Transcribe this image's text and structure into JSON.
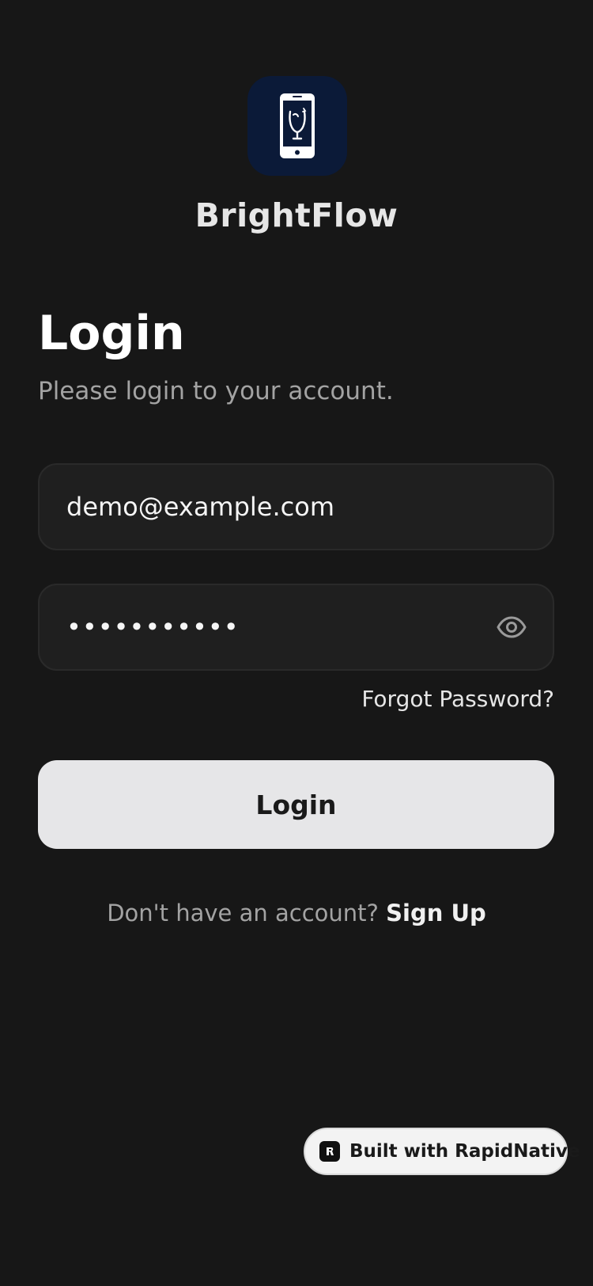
{
  "app": {
    "name": "BrightFlow"
  },
  "login": {
    "title": "Login",
    "subtitle": "Please login to your account.",
    "email_value": "demo@example.com",
    "password_value": "•••••••••••",
    "forgot_password": "Forgot Password?",
    "login_button": "Login",
    "signup_prompt": "Don't have an account?",
    "signup_link": "Sign Up"
  },
  "badge": {
    "label": "Built with RapidNative"
  },
  "icons": {
    "logo": "phone-icon",
    "password_toggle": "eye-icon",
    "badge": "rapidnative-logo-icon"
  },
  "colors": {
    "background": "#171717",
    "logo_tile": "#0b1a38",
    "field_bg": "#1f1f1f",
    "button_bg": "#e6e6e8",
    "muted_text": "#a3a3a3"
  }
}
